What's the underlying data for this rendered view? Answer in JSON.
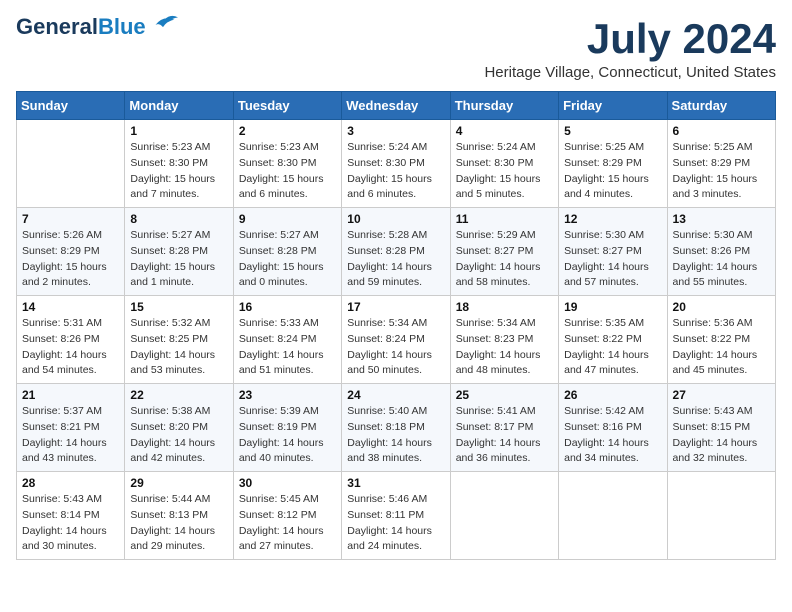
{
  "header": {
    "logo_general": "General",
    "logo_blue": "Blue",
    "month_title": "July 2024",
    "location": "Heritage Village, Connecticut, United States"
  },
  "days_of_week": [
    "Sunday",
    "Monday",
    "Tuesday",
    "Wednesday",
    "Thursday",
    "Friday",
    "Saturday"
  ],
  "weeks": [
    [
      {
        "day": "",
        "info": ""
      },
      {
        "day": "1",
        "info": "Sunrise: 5:23 AM\nSunset: 8:30 PM\nDaylight: 15 hours\nand 7 minutes."
      },
      {
        "day": "2",
        "info": "Sunrise: 5:23 AM\nSunset: 8:30 PM\nDaylight: 15 hours\nand 6 minutes."
      },
      {
        "day": "3",
        "info": "Sunrise: 5:24 AM\nSunset: 8:30 PM\nDaylight: 15 hours\nand 6 minutes."
      },
      {
        "day": "4",
        "info": "Sunrise: 5:24 AM\nSunset: 8:30 PM\nDaylight: 15 hours\nand 5 minutes."
      },
      {
        "day": "5",
        "info": "Sunrise: 5:25 AM\nSunset: 8:29 PM\nDaylight: 15 hours\nand 4 minutes."
      },
      {
        "day": "6",
        "info": "Sunrise: 5:25 AM\nSunset: 8:29 PM\nDaylight: 15 hours\nand 3 minutes."
      }
    ],
    [
      {
        "day": "7",
        "info": "Sunrise: 5:26 AM\nSunset: 8:29 PM\nDaylight: 15 hours\nand 2 minutes."
      },
      {
        "day": "8",
        "info": "Sunrise: 5:27 AM\nSunset: 8:28 PM\nDaylight: 15 hours\nand 1 minute."
      },
      {
        "day": "9",
        "info": "Sunrise: 5:27 AM\nSunset: 8:28 PM\nDaylight: 15 hours\nand 0 minutes."
      },
      {
        "day": "10",
        "info": "Sunrise: 5:28 AM\nSunset: 8:28 PM\nDaylight: 14 hours\nand 59 minutes."
      },
      {
        "day": "11",
        "info": "Sunrise: 5:29 AM\nSunset: 8:27 PM\nDaylight: 14 hours\nand 58 minutes."
      },
      {
        "day": "12",
        "info": "Sunrise: 5:30 AM\nSunset: 8:27 PM\nDaylight: 14 hours\nand 57 minutes."
      },
      {
        "day": "13",
        "info": "Sunrise: 5:30 AM\nSunset: 8:26 PM\nDaylight: 14 hours\nand 55 minutes."
      }
    ],
    [
      {
        "day": "14",
        "info": "Sunrise: 5:31 AM\nSunset: 8:26 PM\nDaylight: 14 hours\nand 54 minutes."
      },
      {
        "day": "15",
        "info": "Sunrise: 5:32 AM\nSunset: 8:25 PM\nDaylight: 14 hours\nand 53 minutes."
      },
      {
        "day": "16",
        "info": "Sunrise: 5:33 AM\nSunset: 8:24 PM\nDaylight: 14 hours\nand 51 minutes."
      },
      {
        "day": "17",
        "info": "Sunrise: 5:34 AM\nSunset: 8:24 PM\nDaylight: 14 hours\nand 50 minutes."
      },
      {
        "day": "18",
        "info": "Sunrise: 5:34 AM\nSunset: 8:23 PM\nDaylight: 14 hours\nand 48 minutes."
      },
      {
        "day": "19",
        "info": "Sunrise: 5:35 AM\nSunset: 8:22 PM\nDaylight: 14 hours\nand 47 minutes."
      },
      {
        "day": "20",
        "info": "Sunrise: 5:36 AM\nSunset: 8:22 PM\nDaylight: 14 hours\nand 45 minutes."
      }
    ],
    [
      {
        "day": "21",
        "info": "Sunrise: 5:37 AM\nSunset: 8:21 PM\nDaylight: 14 hours\nand 43 minutes."
      },
      {
        "day": "22",
        "info": "Sunrise: 5:38 AM\nSunset: 8:20 PM\nDaylight: 14 hours\nand 42 minutes."
      },
      {
        "day": "23",
        "info": "Sunrise: 5:39 AM\nSunset: 8:19 PM\nDaylight: 14 hours\nand 40 minutes."
      },
      {
        "day": "24",
        "info": "Sunrise: 5:40 AM\nSunset: 8:18 PM\nDaylight: 14 hours\nand 38 minutes."
      },
      {
        "day": "25",
        "info": "Sunrise: 5:41 AM\nSunset: 8:17 PM\nDaylight: 14 hours\nand 36 minutes."
      },
      {
        "day": "26",
        "info": "Sunrise: 5:42 AM\nSunset: 8:16 PM\nDaylight: 14 hours\nand 34 minutes."
      },
      {
        "day": "27",
        "info": "Sunrise: 5:43 AM\nSunset: 8:15 PM\nDaylight: 14 hours\nand 32 minutes."
      }
    ],
    [
      {
        "day": "28",
        "info": "Sunrise: 5:43 AM\nSunset: 8:14 PM\nDaylight: 14 hours\nand 30 minutes."
      },
      {
        "day": "29",
        "info": "Sunrise: 5:44 AM\nSunset: 8:13 PM\nDaylight: 14 hours\nand 29 minutes."
      },
      {
        "day": "30",
        "info": "Sunrise: 5:45 AM\nSunset: 8:12 PM\nDaylight: 14 hours\nand 27 minutes."
      },
      {
        "day": "31",
        "info": "Sunrise: 5:46 AM\nSunset: 8:11 PM\nDaylight: 14 hours\nand 24 minutes."
      },
      {
        "day": "",
        "info": ""
      },
      {
        "day": "",
        "info": ""
      },
      {
        "day": "",
        "info": ""
      }
    ]
  ]
}
